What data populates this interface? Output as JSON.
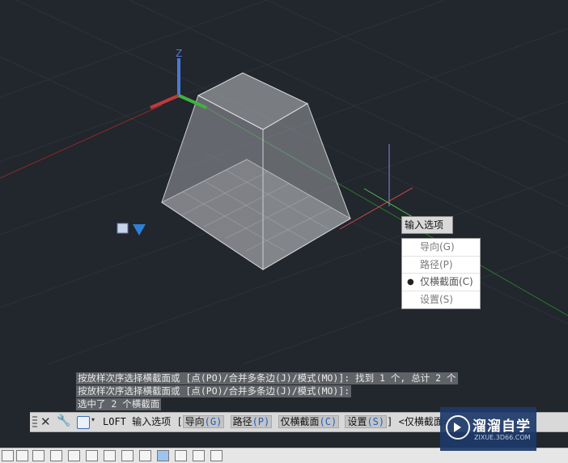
{
  "viewport": {
    "axis_labels": {
      "z": "Z"
    }
  },
  "prompt_tooltip": {
    "label": "输入选项"
  },
  "context_menu": {
    "items": [
      {
        "label": "导向(G)",
        "selected": false
      },
      {
        "label": "路径(P)",
        "selected": false
      },
      {
        "label": "仅横截面(C)",
        "selected": true
      },
      {
        "label": "设置(S)",
        "selected": false
      }
    ],
    "bullet": "●"
  },
  "command_history": [
    "按放样次序选择横截面或 [点(PO)/合并多条边(J)/模式(MO)]: 找到 1 个, 总计 2 个",
    "按放样次序选择横截面或 [点(PO)/合并多条边(J)/模式(MO)]:",
    " 选中了 2 个横截面"
  ],
  "command_line": {
    "close_glyph": "✕",
    "settings_glyph": "🔧",
    "caret_glyph": "▾",
    "command": "LOFT",
    "prompt": "输入选项",
    "open_bracket": "[",
    "options": [
      {
        "label": "导向",
        "key": "(G)"
      },
      {
        "label": "路径",
        "key": "(P)"
      },
      {
        "label": "仅横截面",
        "key": "(C)"
      },
      {
        "label": "设置",
        "key": "(S)"
      }
    ],
    "close_bracket": "]",
    "default": "<仅横截面>"
  },
  "watermark": {
    "title": "溜溜自学",
    "url": "ZIXUE.3D66.COM"
  },
  "colors": {
    "background": "#22262d",
    "accent": "#1f5fbf"
  }
}
